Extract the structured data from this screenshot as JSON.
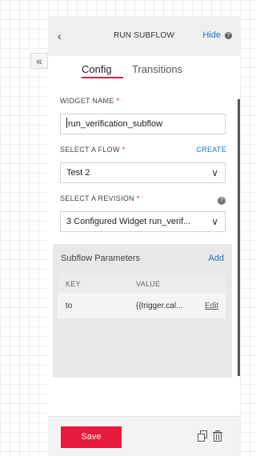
{
  "canvas": {
    "collapse_icon": "chevron-double-left-icon"
  },
  "panel": {
    "header": {
      "back_icon": "chevron-left-icon",
      "title": "RUN SUBFLOW",
      "hide_label": "Hide",
      "help_icon": "question-circle-icon"
    },
    "tabs": [
      {
        "label": "Config",
        "active": true
      },
      {
        "label": "Transitions",
        "active": false
      }
    ],
    "widget_name": {
      "label": "WIDGET NAME",
      "required_mark": "*",
      "value": "run_verification_subflow"
    },
    "flow": {
      "label": "SELECT A FLOW",
      "required_mark": "*",
      "create_label": "CREATE",
      "selected": "Test 2"
    },
    "revision": {
      "label": "SELECT A REVISION",
      "required_mark": "*",
      "help_icon": "question-circle-icon",
      "selected": "3 Configured Widget run_verif..."
    },
    "subflow_parameters": {
      "title": "Subflow Parameters",
      "add_label": "Add",
      "columns": [
        "KEY",
        "VALUE"
      ],
      "rows": [
        {
          "key": "to",
          "value": "{{trigger.cal...",
          "edit_label": "Edit"
        }
      ]
    },
    "footer": {
      "save_label": "Save",
      "duplicate_icon": "duplicate-icon",
      "delete_icon": "trash-icon"
    }
  },
  "colors": {
    "accent": "#e8193a",
    "link": "#1a73c8",
    "tab_underline": "#d6203a"
  }
}
